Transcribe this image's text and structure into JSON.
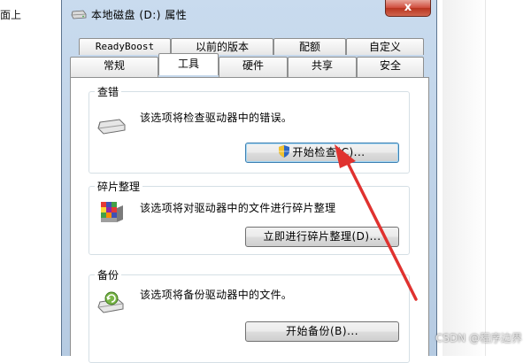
{
  "background": {
    "left_text": "面上"
  },
  "window": {
    "title": "本地磁盘 (D:) 属性",
    "close_label": "x",
    "tabs_row1": [
      "ReadyBoost",
      "以前的版本",
      "配额",
      "自定义"
    ],
    "tabs_row2": [
      "常规",
      "工具",
      "硬件",
      "共享",
      "安全"
    ],
    "active_tab": "工具"
  },
  "sections": {
    "error_check": {
      "label": "查错",
      "description": "该选项将检查驱动器中的错误。",
      "button": "开始检查(C)..."
    },
    "defrag": {
      "label": "碎片整理",
      "description": "该选项将对驱动器中的文件进行碎片整理",
      "button": "立即进行碎片整理(D)..."
    },
    "backup": {
      "label": "备份",
      "description": "该选项将备份驱动器中的文件。",
      "button": "开始备份(B)..."
    }
  },
  "watermark": "CSDN @程序边界",
  "colors": {
    "arrow": "#e0322f",
    "window_frame": "#c9dbee"
  }
}
